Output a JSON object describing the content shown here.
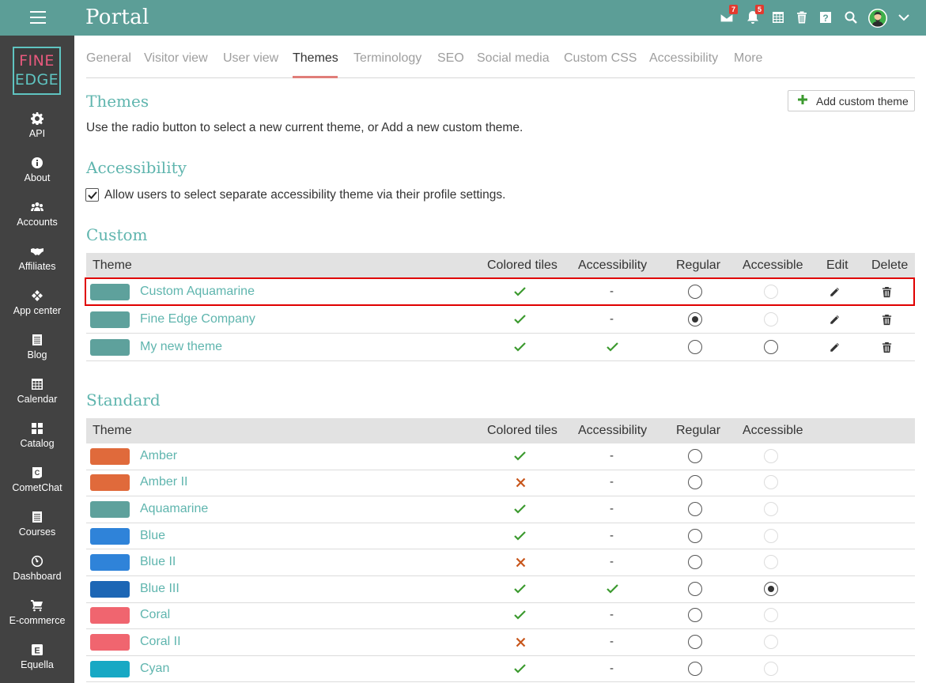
{
  "app": {
    "title": "Portal"
  },
  "topbar": {
    "icons": [
      {
        "name": "messages-icon",
        "badge": "7"
      },
      {
        "name": "notifications-icon",
        "badge": "5"
      },
      {
        "name": "calendar-grid-icon"
      },
      {
        "name": "trash-icon"
      },
      {
        "name": "help-icon"
      },
      {
        "name": "search-icon"
      },
      {
        "name": "avatar"
      },
      {
        "name": "chevron-down-icon"
      }
    ]
  },
  "logo": {
    "line1": "FINE",
    "line2": "EDGE"
  },
  "sidebar": {
    "items": [
      {
        "label": "API",
        "icon": "gear-icon"
      },
      {
        "label": "About",
        "icon": "info-icon"
      },
      {
        "label": "Accounts",
        "icon": "users-icon"
      },
      {
        "label": "Affiliates",
        "icon": "handshake-icon"
      },
      {
        "label": "App center",
        "icon": "cubes-icon"
      },
      {
        "label": "Blog",
        "icon": "blog-icon"
      },
      {
        "label": "Calendar",
        "icon": "calendar-icon"
      },
      {
        "label": "Catalog",
        "icon": "grid-icon"
      },
      {
        "label": "CometChat",
        "icon": "cometchat-icon"
      },
      {
        "label": "Courses",
        "icon": "courses-icon"
      },
      {
        "label": "Dashboard",
        "icon": "gauge-icon"
      },
      {
        "label": "E-commerce",
        "icon": "cart-icon"
      },
      {
        "label": "Equella",
        "icon": "equella-icon"
      }
    ]
  },
  "tabs": [
    {
      "label": "General"
    },
    {
      "label": "Visitor view"
    },
    {
      "label": "User view"
    },
    {
      "label": "Themes",
      "active": true
    },
    {
      "label": "Terminology"
    },
    {
      "label": "SEO"
    },
    {
      "label": "Social media"
    },
    {
      "label": "Custom CSS"
    },
    {
      "label": "Accessibility"
    },
    {
      "label": "More"
    }
  ],
  "themes_section": {
    "heading": "Themes",
    "description": "Use the radio button to select a new current theme, or Add a new custom theme.",
    "add_button": "Add custom theme"
  },
  "accessibility_section": {
    "heading": "Accessibility",
    "checkbox_label": "Allow users to select separate accessibility theme via their profile settings.",
    "checked": true
  },
  "custom_section": {
    "heading": "Custom",
    "columns": [
      "Theme",
      "Colored tiles",
      "Accessibility",
      "Regular",
      "Accessible",
      "Edit",
      "Delete"
    ],
    "rows": [
      {
        "name": "Custom Aquamarine",
        "color": "#5ea19c",
        "colored_tiles": "check",
        "accessibility": "-",
        "regular": false,
        "accessible": "disabled",
        "highlighted": true
      },
      {
        "name": "Fine Edge Company",
        "color": "#5ea19c",
        "colored_tiles": "check",
        "accessibility": "-",
        "regular": true,
        "accessible": "disabled"
      },
      {
        "name": "My new theme",
        "color": "#5ea19c",
        "colored_tiles": "check",
        "accessibility": "check",
        "regular": false,
        "accessible": "enabled"
      }
    ]
  },
  "standard_section": {
    "heading": "Standard",
    "columns": [
      "Theme",
      "Colored tiles",
      "Accessibility",
      "Regular",
      "Accessible"
    ],
    "rows": [
      {
        "name": "Amber",
        "color": "#e06a3b",
        "colored_tiles": "check",
        "accessibility": "-",
        "regular": false,
        "accessible": "disabled"
      },
      {
        "name": "Amber II",
        "color": "#e06a3b",
        "colored_tiles": "cross",
        "accessibility": "-",
        "regular": false,
        "accessible": "disabled"
      },
      {
        "name": "Aquamarine",
        "color": "#5ea19c",
        "colored_tiles": "check",
        "accessibility": "-",
        "regular": false,
        "accessible": "disabled"
      },
      {
        "name": "Blue",
        "color": "#2f83d9",
        "colored_tiles": "check",
        "accessibility": "-",
        "regular": false,
        "accessible": "disabled"
      },
      {
        "name": "Blue II",
        "color": "#2f83d9",
        "colored_tiles": "cross",
        "accessibility": "-",
        "regular": false,
        "accessible": "disabled"
      },
      {
        "name": "Blue III",
        "color": "#1c66b5",
        "colored_tiles": "check",
        "accessibility": "check",
        "regular": false,
        "accessible": "selected"
      },
      {
        "name": "Coral",
        "color": "#f0656f",
        "colored_tiles": "check",
        "accessibility": "-",
        "regular": false,
        "accessible": "disabled"
      },
      {
        "name": "Coral II",
        "color": "#f0656f",
        "colored_tiles": "cross",
        "accessibility": "-",
        "regular": false,
        "accessible": "disabled"
      },
      {
        "name": "Cyan",
        "color": "#17a8c4",
        "colored_tiles": "check",
        "accessibility": "-",
        "regular": false,
        "accessible": "disabled"
      }
    ]
  },
  "colors": {
    "topbar": "#5c9e97",
    "sidebar": "#424242",
    "heading": "#5fb5ae",
    "check": "#3c9a2f",
    "cross": "#c8561b",
    "highlight": "#e00000"
  }
}
